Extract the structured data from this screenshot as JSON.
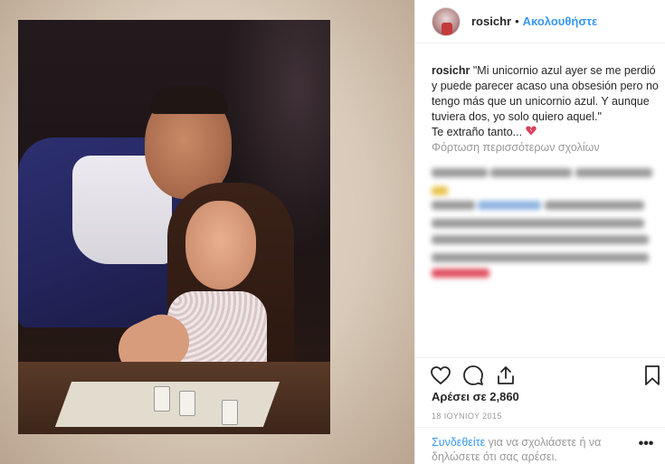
{
  "post": {
    "username": "rosichr",
    "separator": "•",
    "follow_label": "Ακολουθήστε",
    "caption_user": "rosichr",
    "caption_text": "\"Mi unicornio azul ayer se me perdió y puede parecer acaso una obsesión pero no tengo más que un unicornio azul. Y aunque tuviera dos, yo solo quiero aquel.\"",
    "caption_line2": "Te extraño tanto...",
    "caption_emoji": "broken-heart-icon",
    "load_more": "Φόρτωση περισσότερων σχολίων",
    "likes": "Αρέσει σε 2,860",
    "date": "18 ΙΟΥΝΙΟΥ 2015",
    "login_link": "Συνδεθείτε",
    "login_text": " για να σχολιάσετε ή να δηλώσετε ότι σας αρέσει.",
    "more_label": "•••"
  },
  "icons": [
    "heart-icon",
    "comment-icon",
    "share-icon",
    "bookmark-icon"
  ],
  "colors": {
    "accent": "#3897f0",
    "text": "#262626",
    "muted": "#999999",
    "broken_heart": "#d9405d"
  }
}
